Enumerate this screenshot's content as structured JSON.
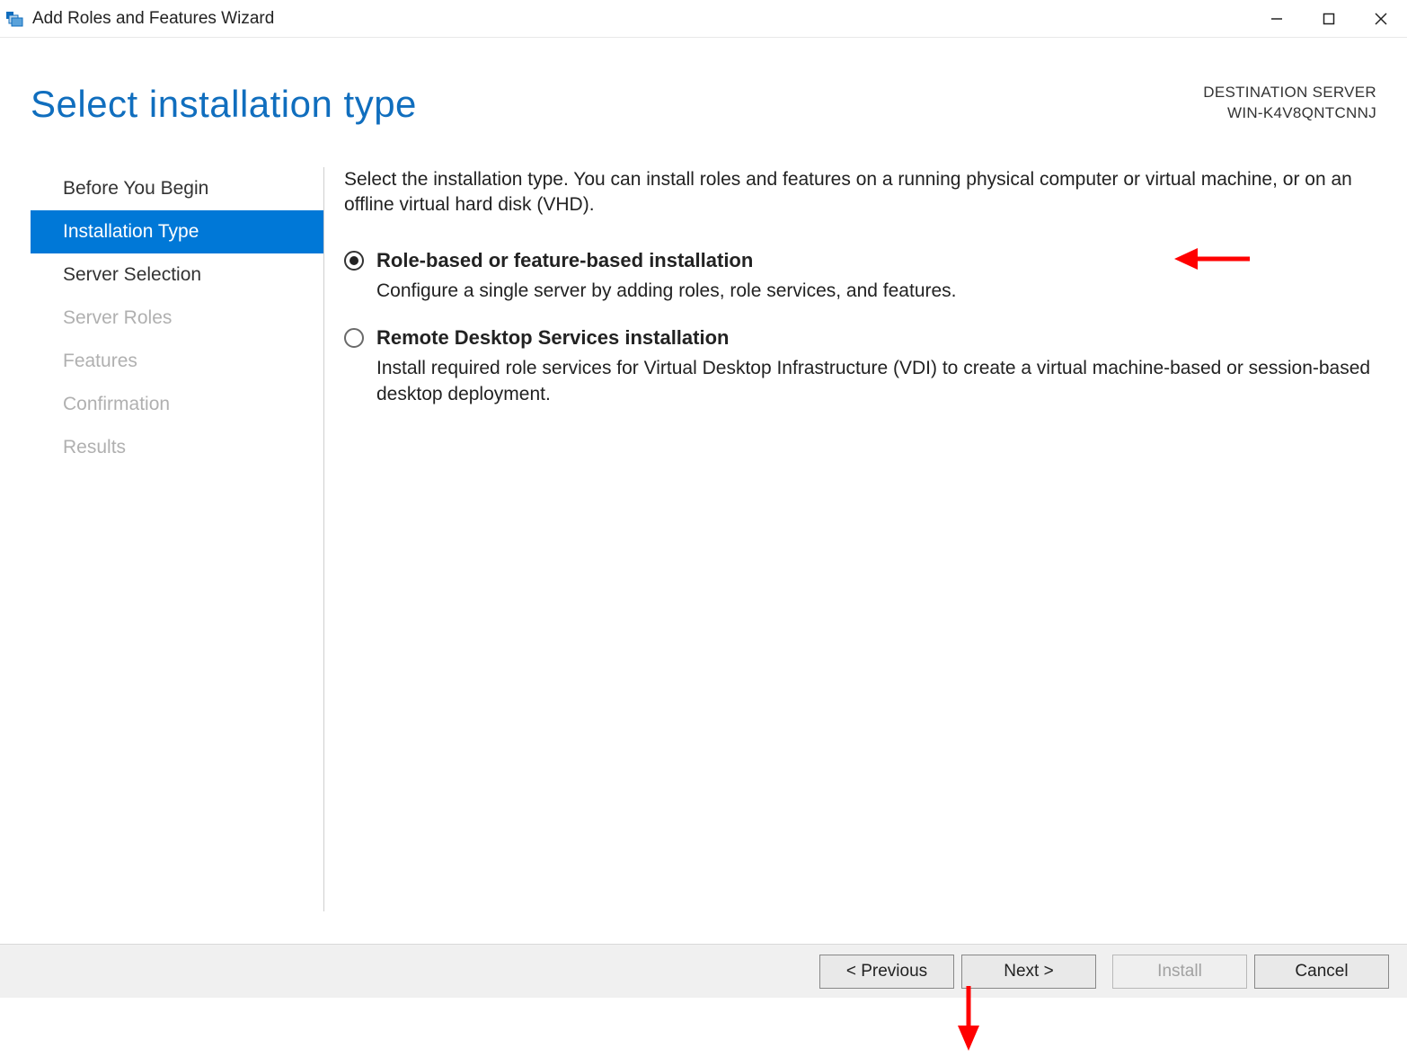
{
  "window": {
    "title": "Add Roles and Features Wizard"
  },
  "header": {
    "page_title": "Select installation type",
    "destination_label": "DESTINATION SERVER",
    "destination_name": "WIN-K4V8QNTCNNJ"
  },
  "sidebar": {
    "items": [
      {
        "label": "Before You Begin",
        "state": "enabled"
      },
      {
        "label": "Installation Type",
        "state": "selected"
      },
      {
        "label": "Server Selection",
        "state": "enabled"
      },
      {
        "label": "Server Roles",
        "state": "disabled"
      },
      {
        "label": "Features",
        "state": "disabled"
      },
      {
        "label": "Confirmation",
        "state": "disabled"
      },
      {
        "label": "Results",
        "state": "disabled"
      }
    ]
  },
  "content": {
    "intro": "Select the installation type. You can install roles and features on a running physical computer or virtual machine, or on an offline virtual hard disk (VHD).",
    "options": [
      {
        "title": "Role-based or feature-based installation",
        "desc": "Configure a single server by adding roles, role services, and features.",
        "selected": true
      },
      {
        "title": "Remote Desktop Services installation",
        "desc": "Install required role services for Virtual Desktop Infrastructure (VDI) to create a virtual machine-based or session-based desktop deployment.",
        "selected": false
      }
    ]
  },
  "footer": {
    "previous": "< Previous",
    "next": "Next >",
    "install": "Install",
    "cancel": "Cancel"
  },
  "annotation": {
    "arrow_color": "#ff0000"
  }
}
